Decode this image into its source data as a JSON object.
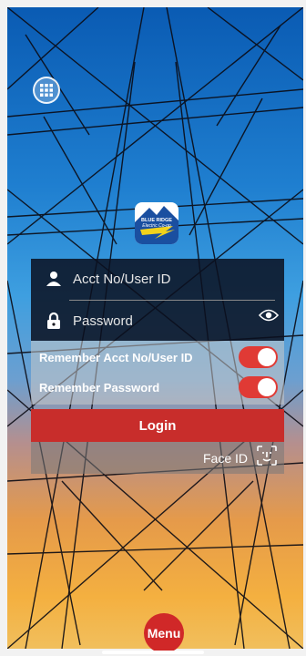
{
  "login_form": {
    "account_placeholder": "Acct No/User ID",
    "password_placeholder": "Password"
  },
  "options": {
    "remember_account_label": "Remember Acct No/User ID",
    "remember_account_on": true,
    "remember_password_label": "Remember Password",
    "remember_password_on": true
  },
  "actions": {
    "login_label": "Login",
    "face_id_label": "Face ID"
  },
  "bottom": {
    "menu_label": "Menu"
  },
  "logo": {
    "line1": "BLUE RIDGE",
    "line2": "Electric Co-op"
  },
  "colors": {
    "accent": "#c82d2b",
    "toggle_on": "#e03a35"
  },
  "icons": {
    "grid": "apps-grid-icon",
    "user": "user-icon",
    "lock": "lock-icon",
    "eye": "eye-icon",
    "face_id": "face-id-icon"
  }
}
